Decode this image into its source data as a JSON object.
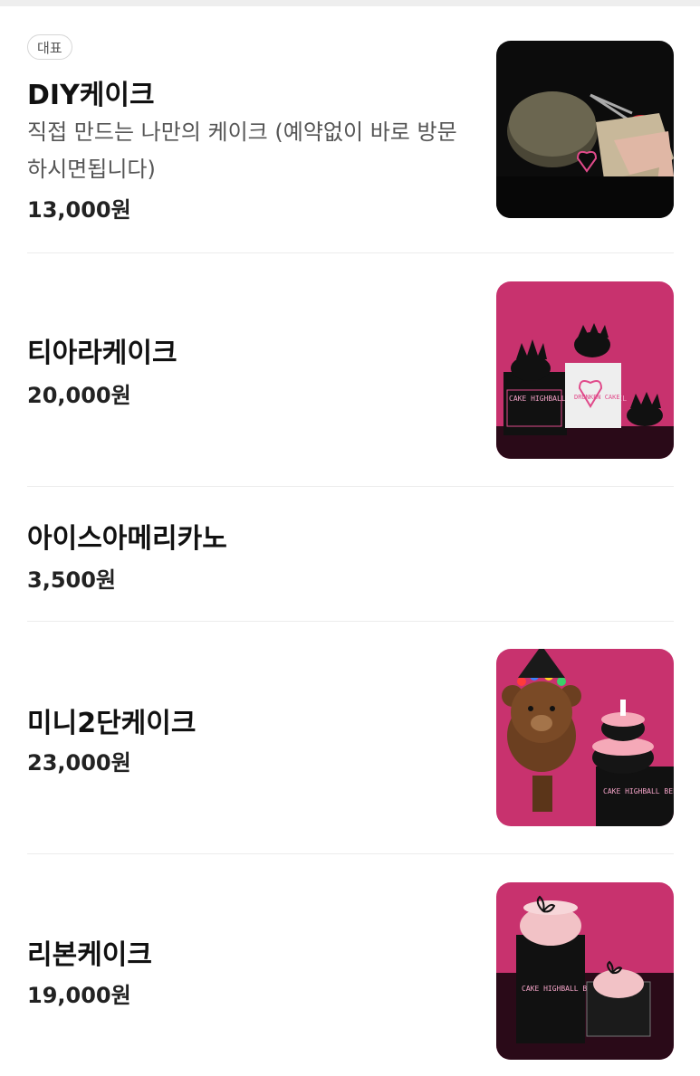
{
  "menu": {
    "items": [
      {
        "badge": "대표",
        "name": "DIY케이크",
        "description": "직접 만드는 나만의 케이크 (예약없이 바로 방문하시면됩니다)",
        "price": "13,000원",
        "image": {
          "alt": "DIY cake kit on dark background",
          "text": ""
        }
      },
      {
        "name": "티아라케이크",
        "price": "20,000원",
        "image": {
          "alt": "Black tiara cakes with pink boxes",
          "box_label_left": "CAKE HIGHBALL BEER COCKTAIL",
          "box_label_right": "DRUNKEN CAKE"
        }
      },
      {
        "name": "아이스아메리카노",
        "price": "3,500원"
      },
      {
        "name": "미니2단케이크",
        "price": "23,000원",
        "image": {
          "alt": "Teddy bear with two-tier black cake",
          "box_label": "CAKE HIGHBALL BEER COCKTAIL"
        }
      },
      {
        "name": "리본케이크",
        "price": "19,000원",
        "image": {
          "alt": "Pink ribbon cakes on dark box",
          "box_label": "CAKE HIGHBALL BEER COCKTAIL"
        }
      }
    ]
  },
  "colors": {
    "title": "#111111",
    "description": "#555555",
    "price": "#222222",
    "divider": "#ececec",
    "pink_bg": "#c8326e",
    "dark": "#0d0d0d"
  }
}
